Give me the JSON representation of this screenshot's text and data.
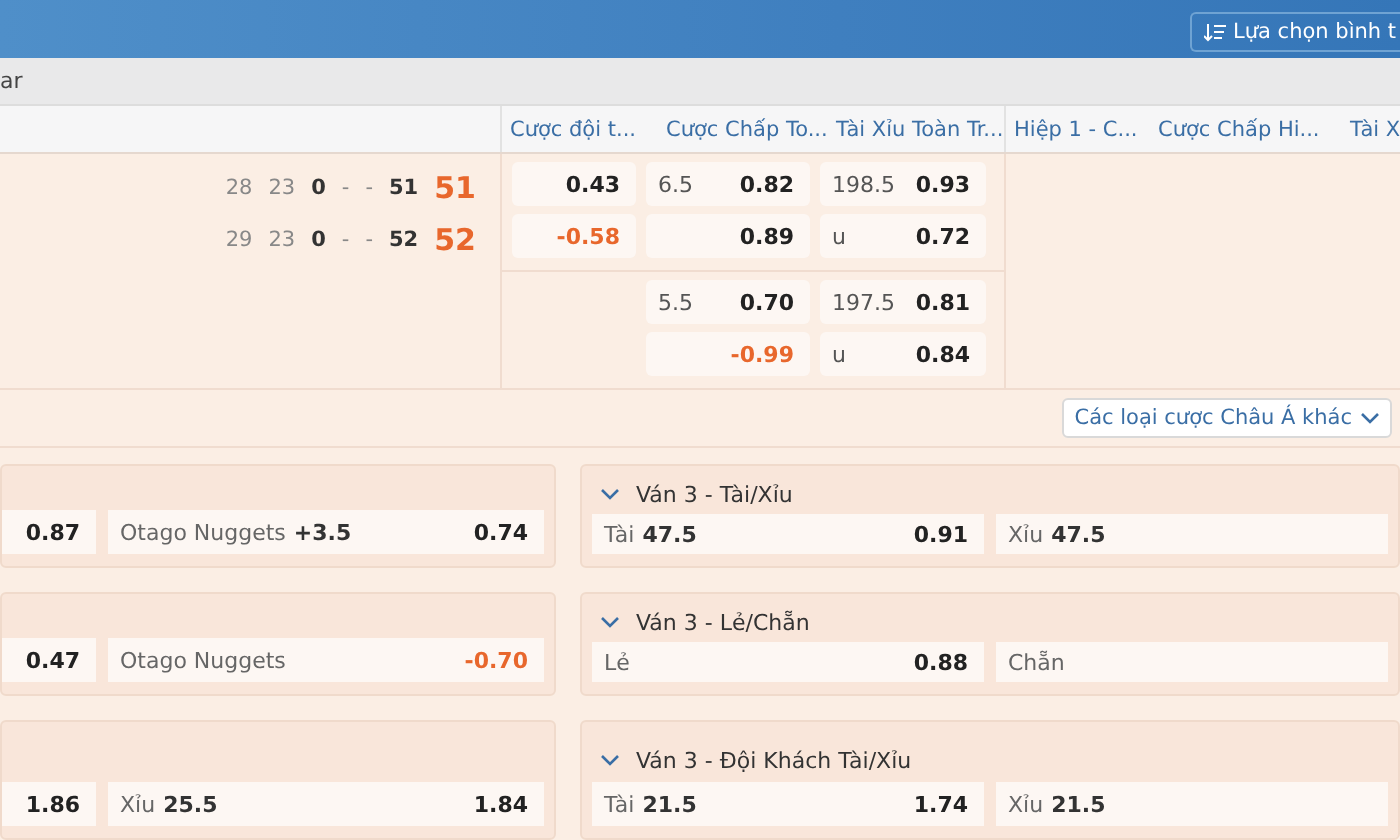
{
  "header": {
    "sort_button": "Lựa chọn bình t"
  },
  "subbar": {
    "text": "ar"
  },
  "column_groups": [
    {
      "columns": [
        "Cược đội t...",
        "Cược Chấp To...",
        "Tài Xỉu Toàn Tr..."
      ]
    },
    {
      "columns": [
        "Hiệp 1 - C...",
        "Cược Chấp Hi...",
        "Tài X"
      ]
    }
  ],
  "match": {
    "teams": [
      {
        "stats": [
          "28",
          "23"
        ],
        "current": "0",
        "periods": [
          "-",
          "-"
        ],
        "score": "51",
        "total": "51"
      },
      {
        "stats": [
          "29",
          "23"
        ],
        "current": "0",
        "periods": [
          "-",
          "-"
        ],
        "score": "52",
        "total": "52"
      }
    ],
    "odds_blocks": [
      {
        "rows": [
          [
            {
              "odds": "0.43",
              "negative": false
            },
            {
              "line": "6.5",
              "odds": "0.82",
              "negative": false
            },
            {
              "line": "198.5",
              "odds": "0.93",
              "negative": false
            }
          ],
          [
            {
              "odds": "-0.58",
              "negative": true
            },
            {
              "odds": "0.89",
              "negative": false
            },
            {
              "line": "u",
              "odds": "0.72",
              "negative": false
            }
          ]
        ]
      },
      {
        "rows": [
          [
            null,
            {
              "line": "5.5",
              "odds": "0.70",
              "negative": false
            },
            {
              "line": "197.5",
              "odds": "0.81",
              "negative": false
            }
          ],
          [
            null,
            {
              "odds": "-0.99",
              "negative": true
            },
            {
              "line": "u",
              "odds": "0.84",
              "negative": false
            }
          ]
        ]
      }
    ]
  },
  "more_dropdown": "Các loại cược Châu Á khác",
  "left_cards": [
    {
      "cells": [
        {
          "odds": "0.87",
          "negative": false
        },
        {
          "label": "Otago Nuggets",
          "line": "+3.5",
          "odds": "0.74",
          "negative": false
        }
      ]
    },
    {
      "cells": [
        {
          "odds": "0.47",
          "negative": false
        },
        {
          "label": "Otago Nuggets",
          "odds": "-0.70",
          "negative": true
        }
      ]
    },
    {
      "cells": [
        {
          "odds": "1.86",
          "negative": false
        },
        {
          "label": "Xỉu",
          "line": "25.5",
          "odds": "1.84",
          "negative": false
        }
      ]
    }
  ],
  "right_cards": [
    {
      "title": "Ván 3 - Tài/Xỉu",
      "expanded": true,
      "cells": [
        {
          "label": "Tài",
          "line": "47.5",
          "odds": "0.91",
          "negative": false
        },
        {
          "label": "Xỉu",
          "line": "47.5"
        }
      ]
    },
    {
      "title": "Ván 3 - Lẻ/Chẵn",
      "expanded": true,
      "cells": [
        {
          "label": "Lẻ",
          "odds": "0.88",
          "negative": false
        },
        {
          "label": "Chẵn"
        }
      ]
    },
    {
      "title": "Ván 3 - Đội Khách Tài/Xỉu",
      "expanded": true,
      "cells": [
        {
          "label": "Tài",
          "line": "21.5",
          "odds": "1.74",
          "negative": false
        },
        {
          "label": "Xỉu",
          "line": "21.5"
        }
      ]
    }
  ]
}
